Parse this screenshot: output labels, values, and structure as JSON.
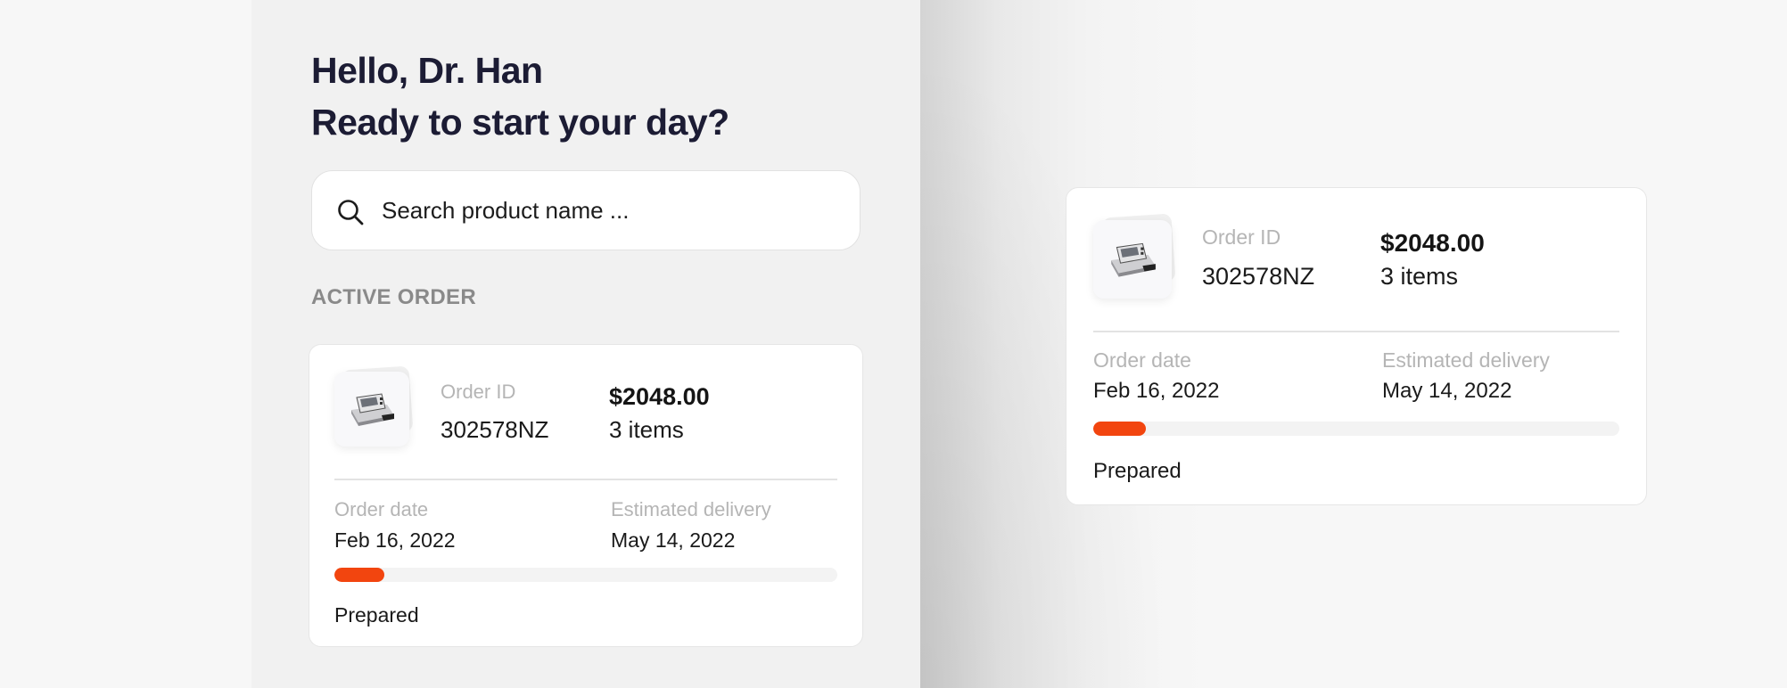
{
  "greeting": {
    "line1": "Hello, Dr. Han",
    "line2": "Ready to start your day?"
  },
  "search": {
    "placeholder": "Search product name ...",
    "icon": "search-icon"
  },
  "section": {
    "title": "ACTIVE ORDER"
  },
  "order": {
    "id_label": "Order ID",
    "id": "302578NZ",
    "price": "$2048.00",
    "items": "3 items",
    "order_date_label": "Order date",
    "order_date": "Feb 16, 2022",
    "delivery_label": "Estimated delivery",
    "delivery_date": "May 14, 2022",
    "progress": 0.1,
    "status": "Prepared",
    "product_icon": "scale-icon"
  },
  "colors": {
    "accent": "#f2450f",
    "heading": "#1c1c34",
    "muted": "#b5b5b5",
    "section": "#8a8a8a"
  }
}
